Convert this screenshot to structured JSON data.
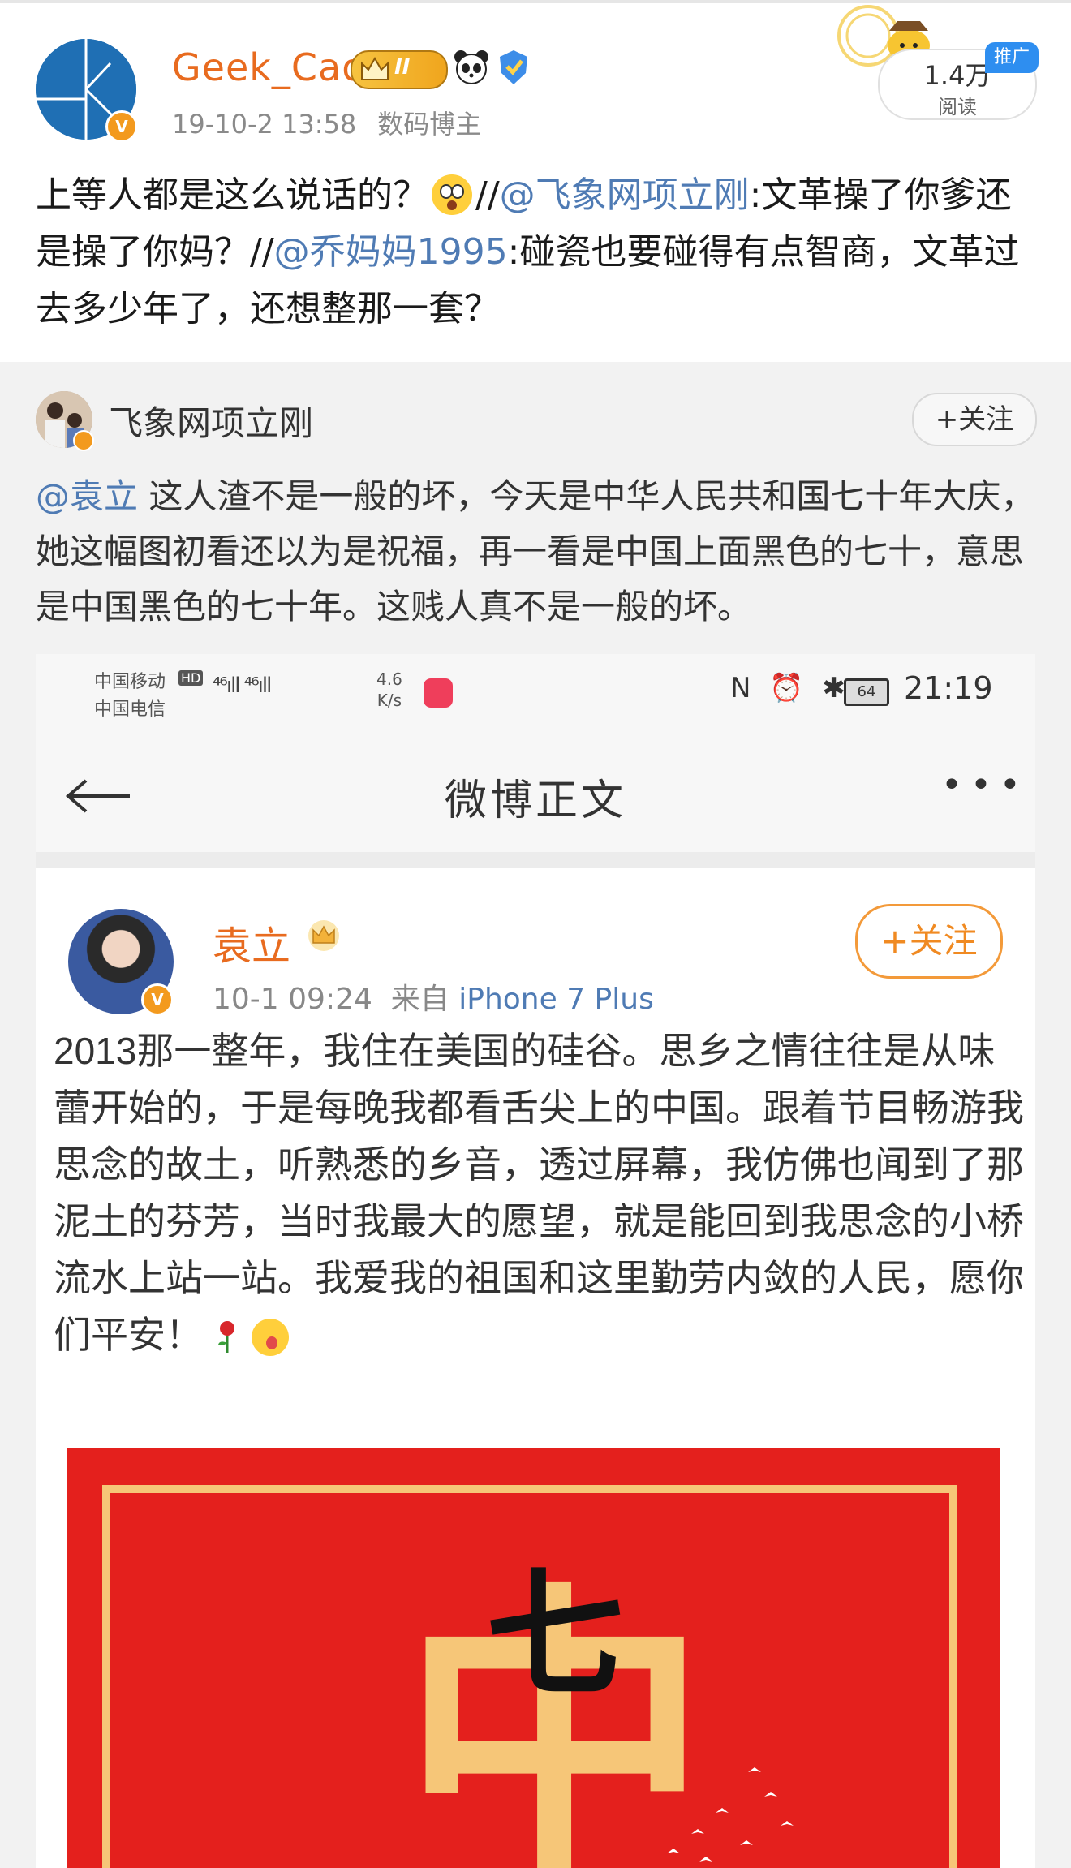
{
  "post": {
    "username": "Geek_Cao",
    "level_badge": "II",
    "timestamp": "19-10-2 13:58",
    "category": "数码博主",
    "reads_count": "1.4万",
    "reads_label": "阅读",
    "ad_tag": "推广",
    "text_parts": {
      "t1": "上等人都是这么说话的？",
      "t2": "//",
      "m1": "@飞象网项立刚",
      "t3": ":文革操了你爹还是操了你妈？//",
      "m2": "@乔妈妈1995",
      "t4": ":碰瓷也要碰得有点智商，文革过去多少年了，还想整那一套？"
    }
  },
  "repost": {
    "username": "飞象网项立刚",
    "follow_label": "+关注",
    "mention": "@袁立",
    "text": " 这人渣不是一般的坏，今天是中华人民共和国七十年大庆，她这幅图初看还以为是祝福，再一看是中国上面黑色的七十，意思是中国黑色的七十年。这贱人真不是一般的坏。"
  },
  "screenshot": {
    "status_bar": {
      "carrier1": "中国移动",
      "carrier2": "中国电信",
      "hd": "HD",
      "signal": "⁴⁶ıll ⁴⁶ıll",
      "speed_value": "4.6",
      "speed_unit": "K/s",
      "icons": "N ⏰ ✱",
      "battery": "64",
      "time": "21:19"
    },
    "nav": {
      "title": "微博正文",
      "more": "•••"
    },
    "post": {
      "username": "袁立",
      "follow_label": "+关注",
      "time": "10-1 09:24",
      "source_prefix": "来自 ",
      "device": "iPhone 7 Plus",
      "text": "2013那一整年，我住在美国的硅谷。思乡之情往往是从味蕾开始的，于是每晚我都看舌尖上的中国。跟着节目畅游我思念的故土，听熟悉的乡音，透过屏幕，我仿佛也闻到了那泥土的芬芳，当时我最大的愿望，就是能回到我思念的小桥流水上站一站。我爱我的祖国和这里勤劳内敛的人民，愿你们平安！",
      "poster_chars": [
        "中",
        "七"
      ]
    }
  }
}
